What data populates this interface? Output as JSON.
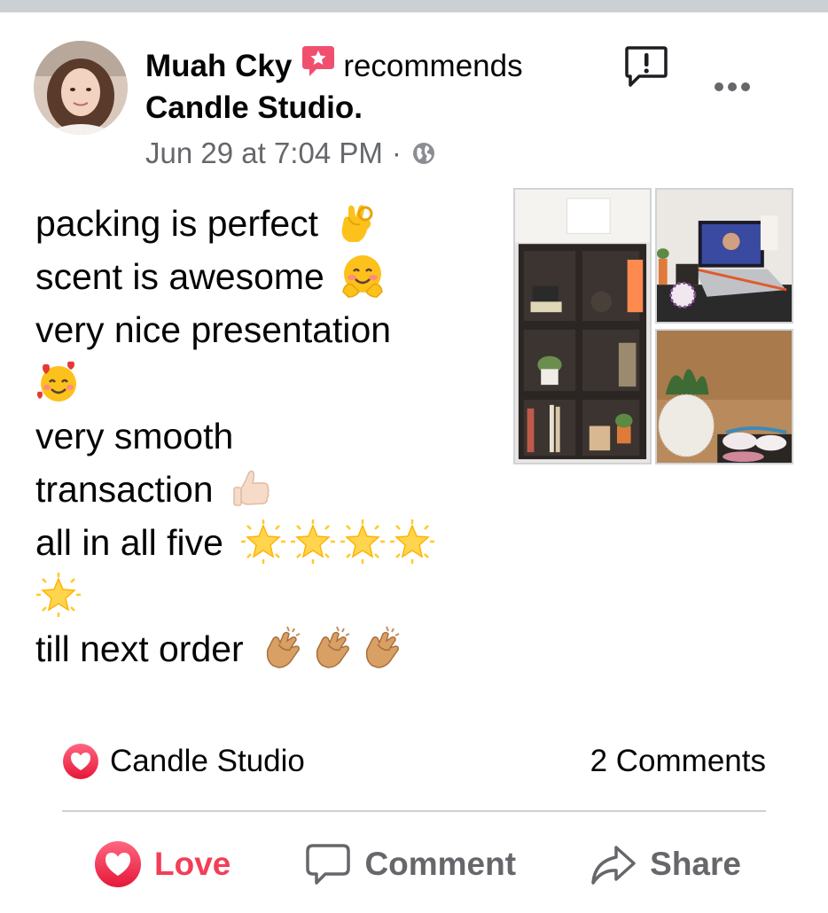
{
  "post": {
    "author": "Muah Cky",
    "verb": "recommends",
    "page_name": "Candle Studio",
    "page_suffix": ".",
    "timestamp": "Jun 29 at 7:04 PM",
    "separator": "·",
    "privacy_icon": "globe-icon",
    "lines": [
      {
        "text": "packing is perfect",
        "emoji": [
          "ok-hand"
        ]
      },
      {
        "text": "scent is awesome",
        "emoji": [
          "hugging-face"
        ]
      },
      {
        "text": "very nice presentation",
        "emoji": []
      },
      {
        "text": "",
        "emoji": [
          "smiling-face-with-hearts"
        ]
      },
      {
        "text": "very smooth",
        "emoji": []
      },
      {
        "text": "transaction",
        "emoji": [
          "thumbs-up"
        ]
      },
      {
        "text": "all in all five",
        "emoji": [
          "glowing-star",
          "glowing-star",
          "glowing-star",
          "glowing-star"
        ]
      },
      {
        "text": "",
        "emoji": [
          "glowing-star"
        ]
      },
      {
        "text": "till next order",
        "emoji": [
          "clapping-hands",
          "clapping-hands",
          "clapping-hands"
        ]
      }
    ]
  },
  "reactions": {
    "reaction_icon": "love-reaction-icon",
    "label": "Candle Studio",
    "comments": "2 Comments"
  },
  "actions": {
    "love": "Love",
    "comment": "Comment",
    "share": "Share"
  },
  "colors": {
    "love_red": "#f33e58",
    "secondary_text": "#65676b",
    "recommend_badge": "#f0506e",
    "divider": "#ced0d4"
  }
}
